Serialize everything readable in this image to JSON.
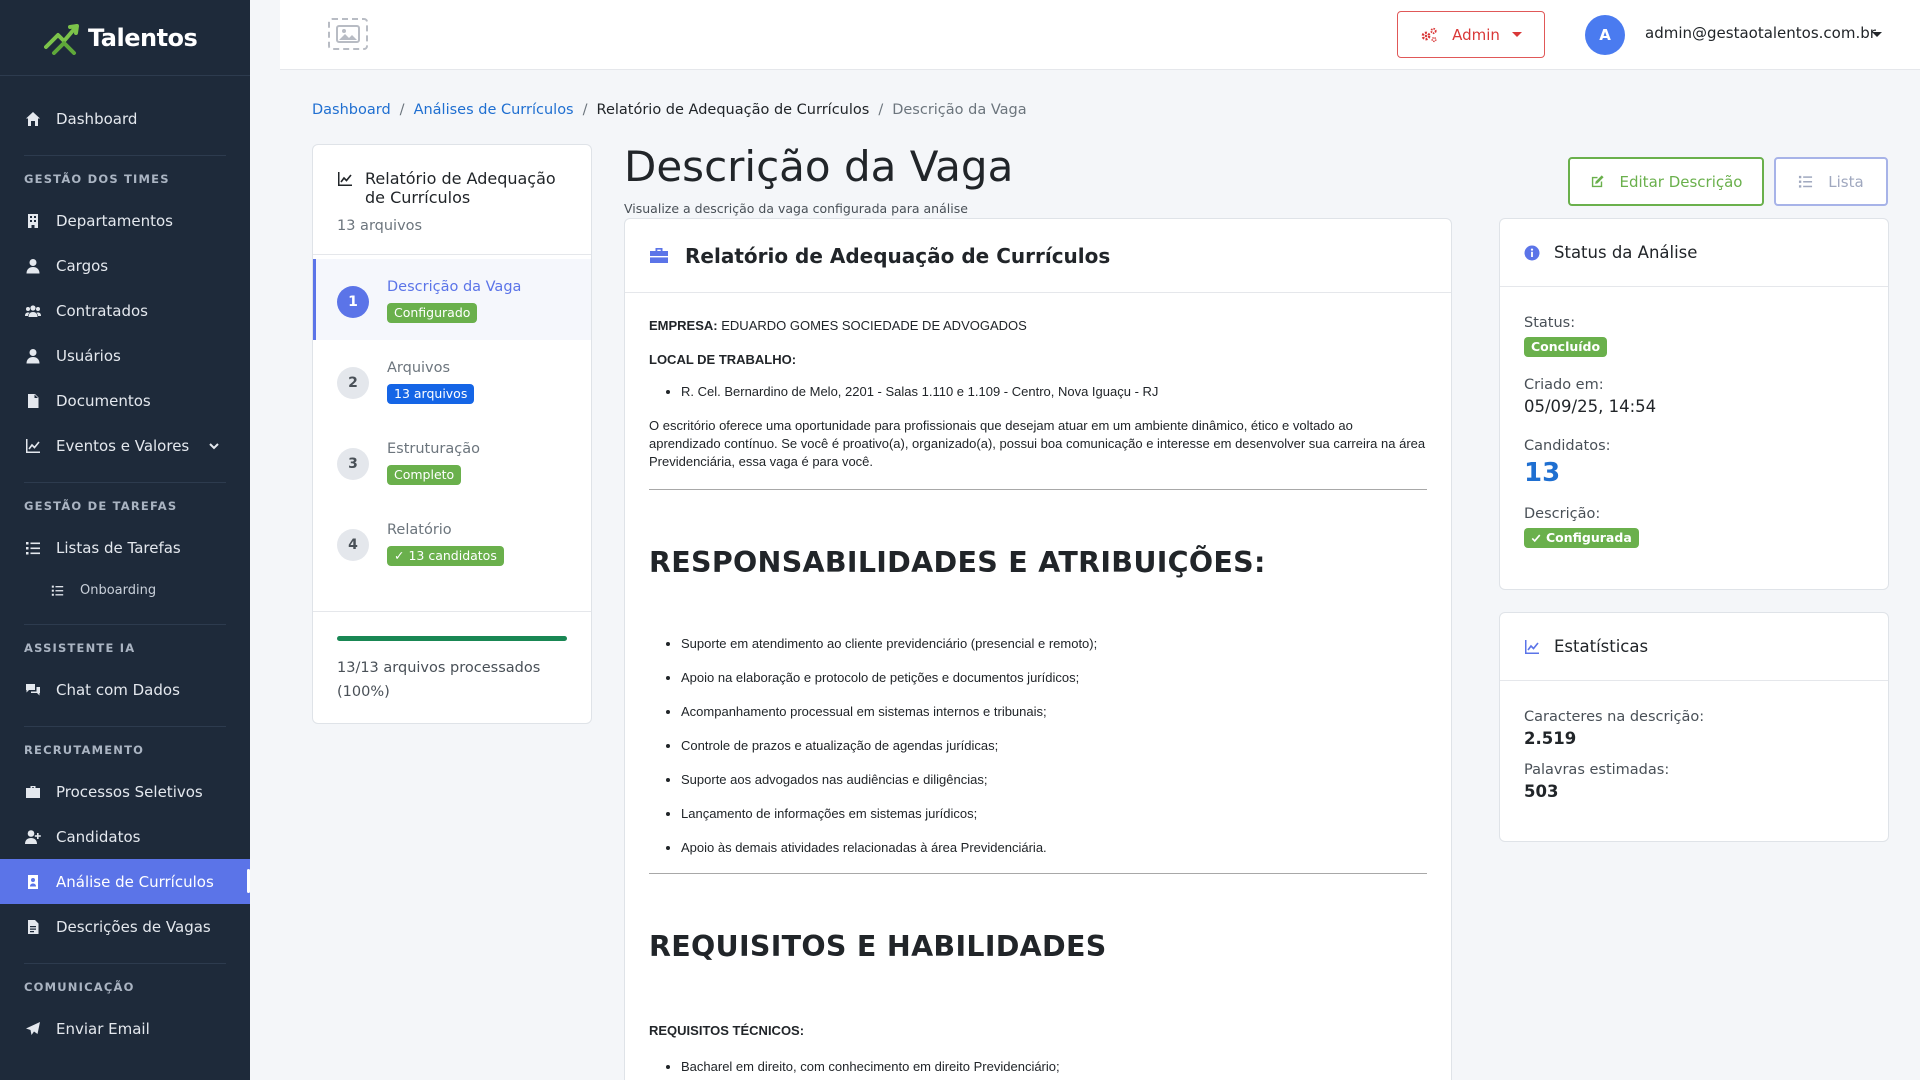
{
  "brand": {
    "name": "Talentos"
  },
  "sidebar": {
    "dashboard": "Dashboard",
    "section_times": "GESTÃO DOS TIMES",
    "departamentos": "Departamentos",
    "cargos": "Cargos",
    "contratados": "Contratados",
    "usuarios": "Usuários",
    "documentos": "Documentos",
    "eventos": "Eventos e Valores",
    "section_tarefas": "GESTÃO DE TAREFAS",
    "listas": "Listas de Tarefas",
    "onboarding": "Onboarding",
    "section_ia": "ASSISTENTE IA",
    "chat": "Chat com Dados",
    "section_recrutamento": "RECRUTAMENTO",
    "processos": "Processos Seletivos",
    "candidatos": "Candidatos",
    "analise": "Análise de Currículos",
    "descricoes": "Descrições de Vagas",
    "section_comunicacao": "COMUNICAÇÃO",
    "enviar_email": "Enviar Email"
  },
  "topbar": {
    "admin_label": "Admin",
    "avatar_letter": "A",
    "user_email": "admin@gestaotalentos.com.br"
  },
  "breadcrumb": {
    "items": [
      "Dashboard",
      "Análises de Currículos",
      "Relatório de Adequação de Currículos",
      "Descrição da Vaga"
    ]
  },
  "steps": {
    "title": "Relatório de Adequação de Currículos",
    "subtitle": "13 arquivos",
    "list": [
      {
        "num": "1",
        "label": "Descrição da Vaga",
        "badge": "Configurado"
      },
      {
        "num": "2",
        "label": "Arquivos",
        "badge": "13 arquivos"
      },
      {
        "num": "3",
        "label": "Estruturação",
        "badge": "Completo"
      },
      {
        "num": "4",
        "label": "Relatório",
        "badge": "✓ 13 candidatos"
      }
    ],
    "progress_percent": 100,
    "progress_text": "13/13 arquivos processados (100%)"
  },
  "main": {
    "title": "Descrição da Vaga",
    "subtitle": "Visualize a descrição da vaga configurada para análise",
    "edit_button": "Editar Descrição",
    "list_button": "Lista"
  },
  "description": {
    "card_title": "Relatório de Adequação de Currículos",
    "empresa_label": "EMPRESA:",
    "empresa_value": "EDUARDO GOMES SOCIEDADE DE ADVOGADOS",
    "local_label": "LOCAL DE TRABALHO:",
    "local_items": [
      "R. Cel. Bernardino de Melo, 2201 - Salas 1.110 e 1.109 - Centro, Nova Iguaçu - RJ"
    ],
    "intro": "O escritório oferece uma oportunidade para profissionais que desejam atuar em um ambiente dinâmico, ético e voltado ao aprendizado contínuo. Se você é proativo(a), organizado(a), possui boa comunicação e interesse em desenvolver sua carreira na área Previdenciária, essa vaga é para você.",
    "resp_title": "RESPONSABILIDADES E ATRIBUIÇÕES:",
    "resp_items": [
      "Suporte em atendimento ao cliente previdenciário (presencial e remoto);",
      "Apoio na elaboração e protocolo de petições e documentos jurídicos;",
      "Acompanhamento processual em sistemas internos e tribunais;",
      "Controle de prazos e atualização de agendas jurídicas;",
      "Suporte aos advogados nas audiências e diligências;",
      "Lançamento de informações em sistemas jurídicos;",
      "Apoio às demais atividades relacionadas à área Previdenciária."
    ],
    "req_title": "REQUISITOS E HABILIDADES",
    "req_tech_label": "REQUISITOS TÉCNICOS:",
    "req_items": [
      "Bacharel em direito, com conhecimento em direito Previdenciário;"
    ]
  },
  "status": {
    "title": "Status da Análise",
    "status_label": "Status:",
    "status_value": "Concluído",
    "created_label": "Criado em:",
    "created_value": "05/09/25, 14:54",
    "candidates_label": "Candidatos:",
    "candidates_value": "13",
    "desc_label": "Descrição:",
    "desc_value": "Configurada"
  },
  "stats": {
    "title": "Estatísticas",
    "chars_label": "Caracteres na descrição:",
    "chars_value": "2.519",
    "words_label": "Palavras estimadas:",
    "words_value": "503"
  },
  "colors": {
    "sidebar_bg": "#1e2a3a",
    "accent": "#5b74e8",
    "success": "#6ab04c",
    "primary": "#1565e6",
    "danger": "#d93838"
  }
}
